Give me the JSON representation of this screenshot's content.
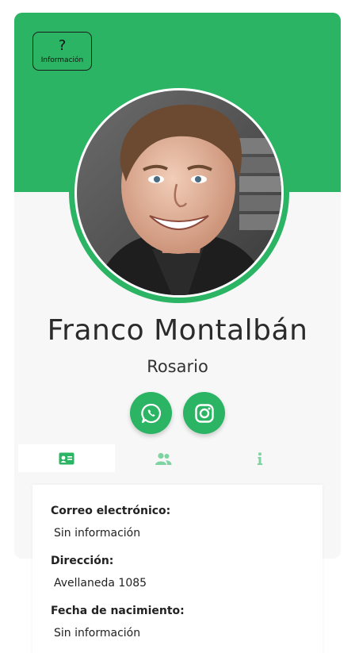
{
  "info_button": {
    "symbol": "?",
    "label": "Información"
  },
  "profile": {
    "name": "Franco Montalbán",
    "city": "Rosario",
    "photo_description": "avatar-photo"
  },
  "social": [
    {
      "name": "whatsapp-icon"
    },
    {
      "name": "instagram-icon"
    }
  ],
  "tabs": [
    {
      "icon": "id-card-icon",
      "active": true
    },
    {
      "icon": "users-icon",
      "active": false
    },
    {
      "icon": "info-icon",
      "active": false
    }
  ],
  "details": [
    {
      "label": "Correo electrónico:",
      "value": "Sin información"
    },
    {
      "label": "Dirección:",
      "value": "Avellaneda 1085"
    },
    {
      "label": "Fecha de nacimiento:",
      "value": "Sin información"
    }
  ],
  "colors": {
    "accent": "#2ab463",
    "tab_icon_muted": "#7fd3a2",
    "card_background": "#f7f7f7"
  }
}
